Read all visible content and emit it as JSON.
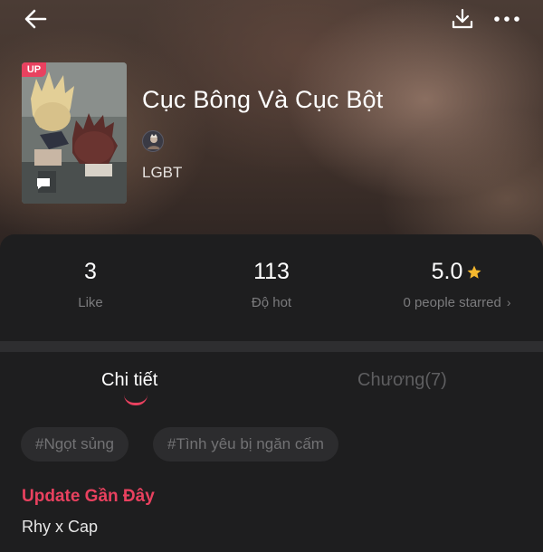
{
  "header": {
    "back_icon": "arrow-left-icon",
    "download_icon": "download-icon",
    "more_icon": "more-horizontal-icon"
  },
  "story": {
    "badge": "UP",
    "title": "Cục Bông Và Cục Bột",
    "genre": "LGBT"
  },
  "stats": {
    "likes": {
      "value": "3",
      "label": "Like"
    },
    "hot": {
      "value": "113",
      "label": "Độ hot"
    },
    "rating": {
      "value": "5.0",
      "label": "0 people starred",
      "chevron": "›"
    }
  },
  "tabs": [
    {
      "label": "Chi tiết",
      "active": true
    },
    {
      "label": "Chương(7)",
      "active": false
    }
  ],
  "tags": [
    "#Ngọt sủng",
    "#Tình yêu bị ngăn cấm"
  ],
  "update": {
    "title": "Update Gần Đây",
    "text": "Rhy x Cap"
  },
  "colors": {
    "accent": "#e9415f",
    "star": "#f5b82e",
    "card_bg": "#1e1e1f"
  }
}
